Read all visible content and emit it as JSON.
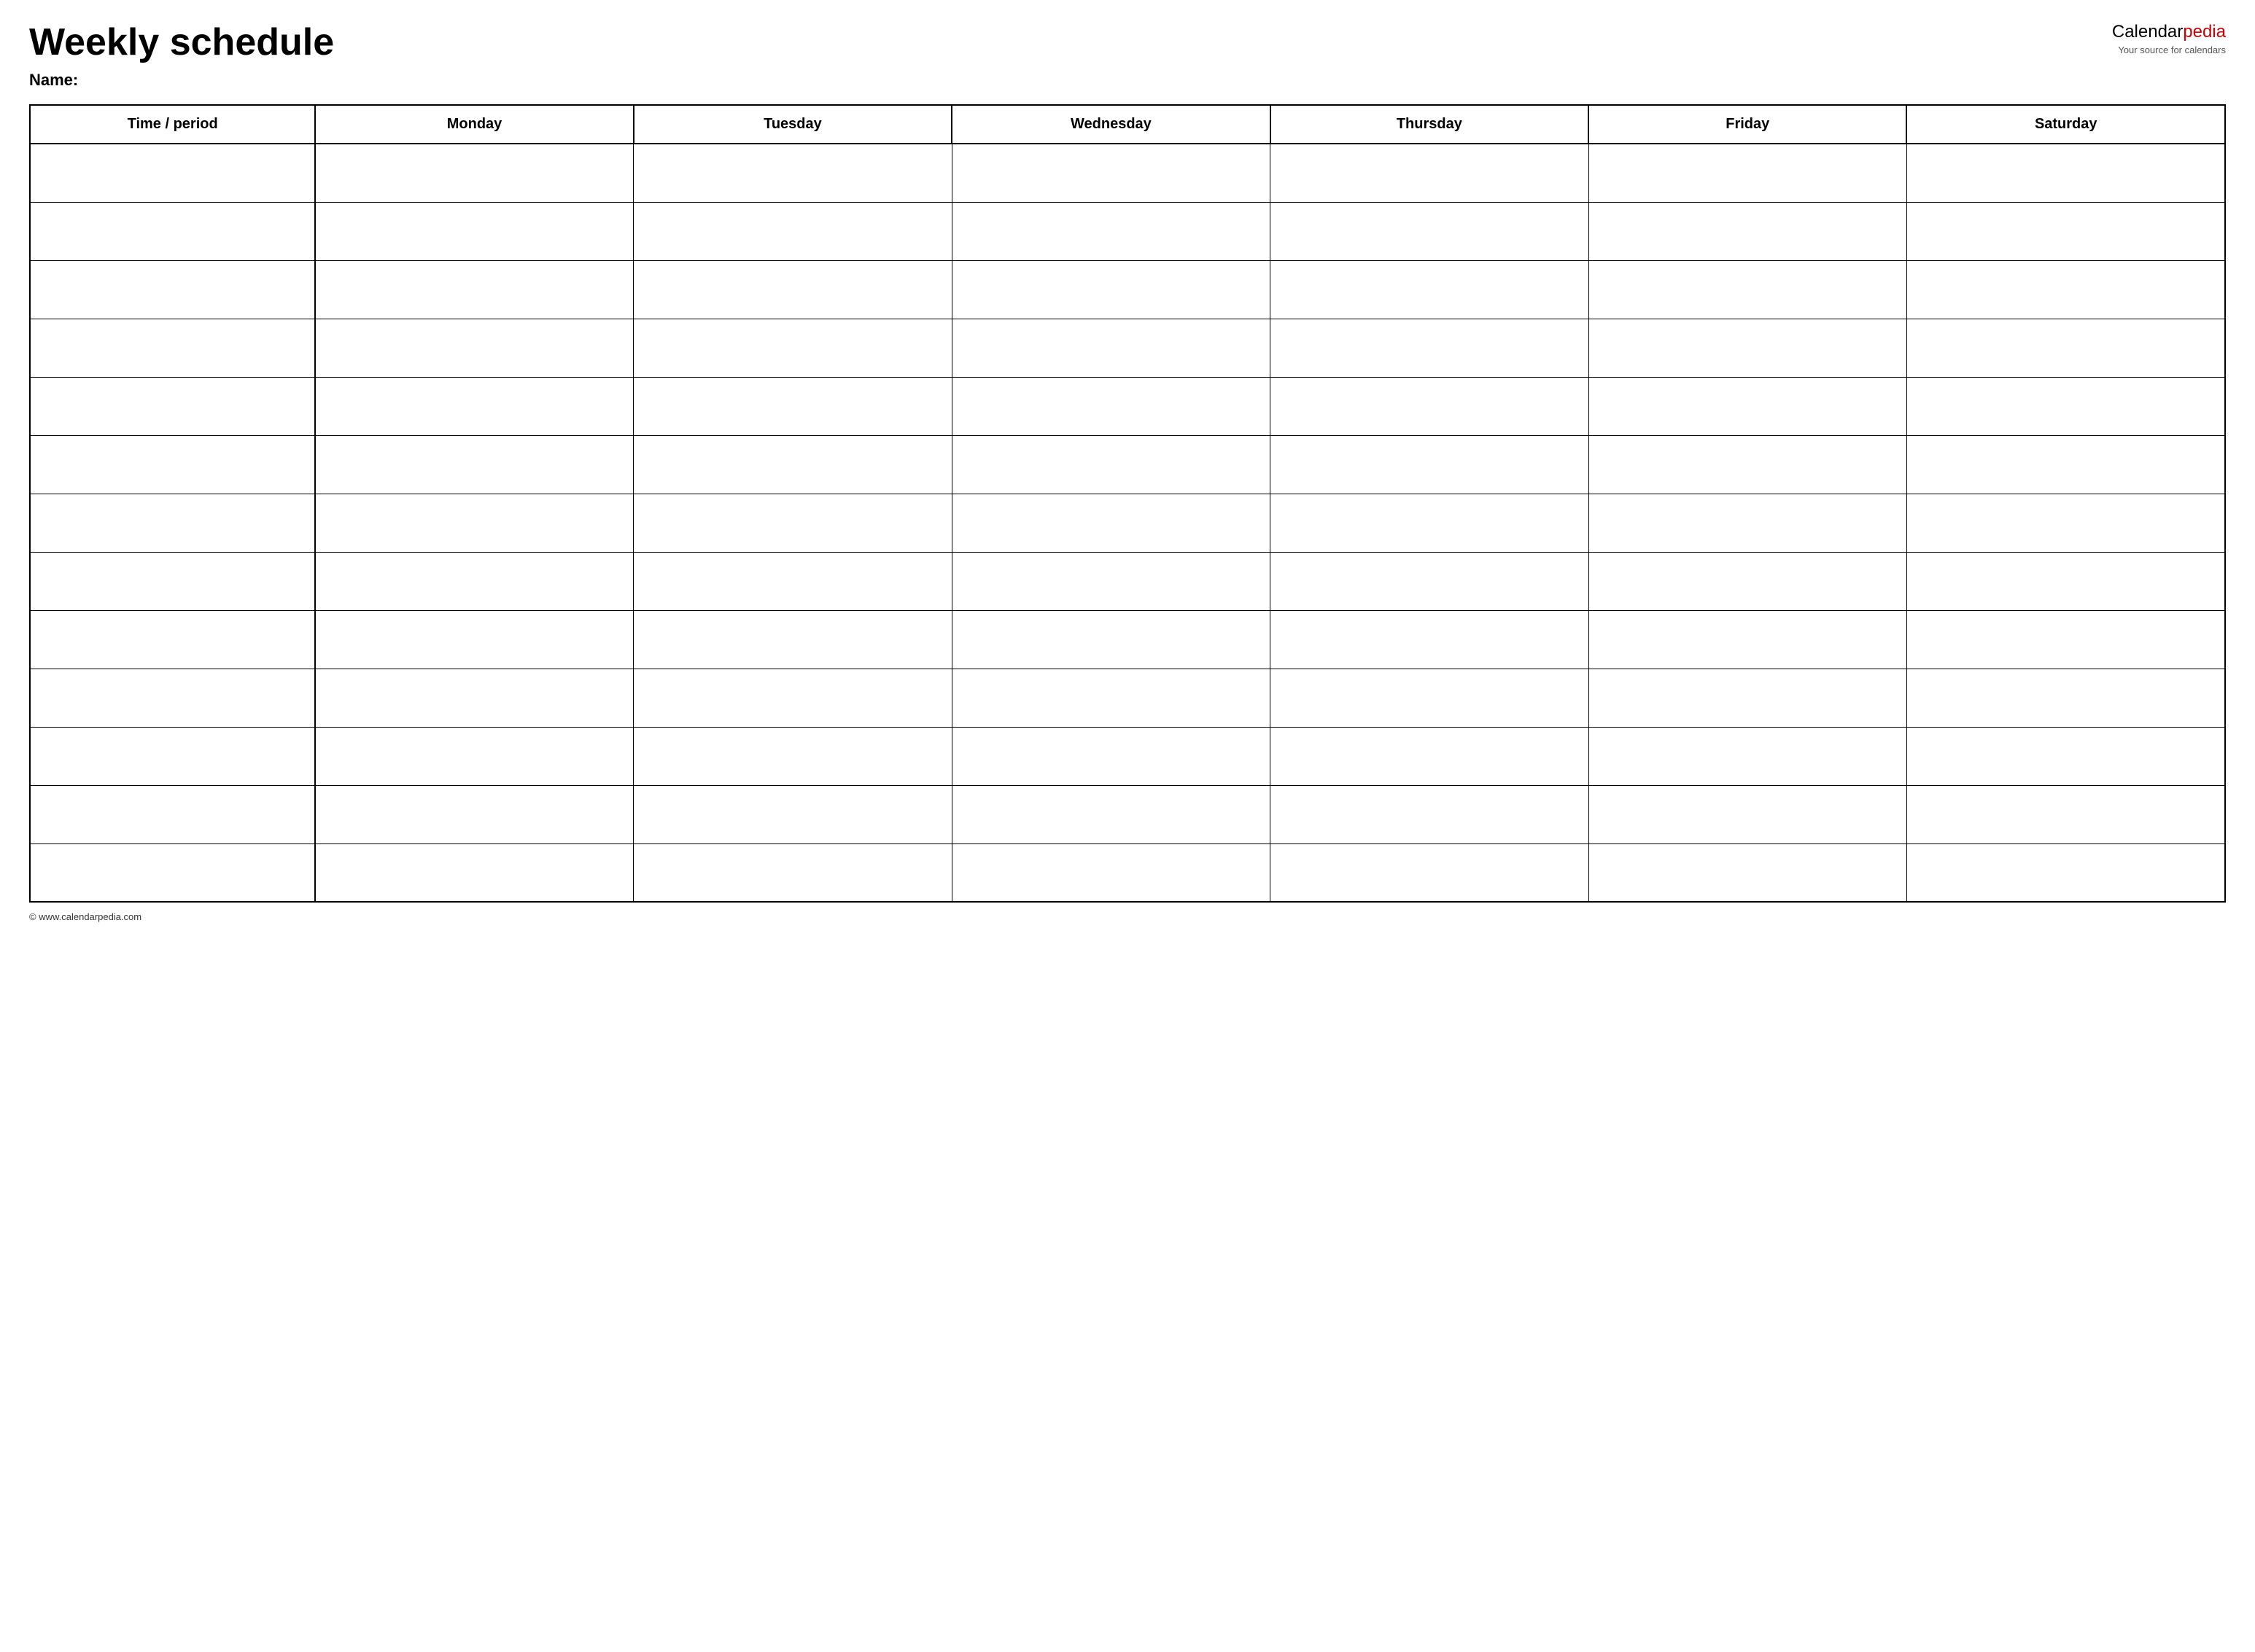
{
  "header": {
    "title": "Weekly schedule",
    "name_label": "Name:",
    "logo": {
      "calendar_text": "Calendar",
      "pedia_text": "pedia",
      "tagline": "Your source for calendars"
    }
  },
  "table": {
    "columns": [
      {
        "key": "time",
        "label": "Time / period"
      },
      {
        "key": "monday",
        "label": "Monday"
      },
      {
        "key": "tuesday",
        "label": "Tuesday"
      },
      {
        "key": "wednesday",
        "label": "Wednesday"
      },
      {
        "key": "thursday",
        "label": "Thursday"
      },
      {
        "key": "friday",
        "label": "Friday"
      },
      {
        "key": "saturday",
        "label": "Saturday"
      }
    ],
    "row_count": 13
  },
  "footer": {
    "copyright": "© www.calendarpedia.com"
  }
}
